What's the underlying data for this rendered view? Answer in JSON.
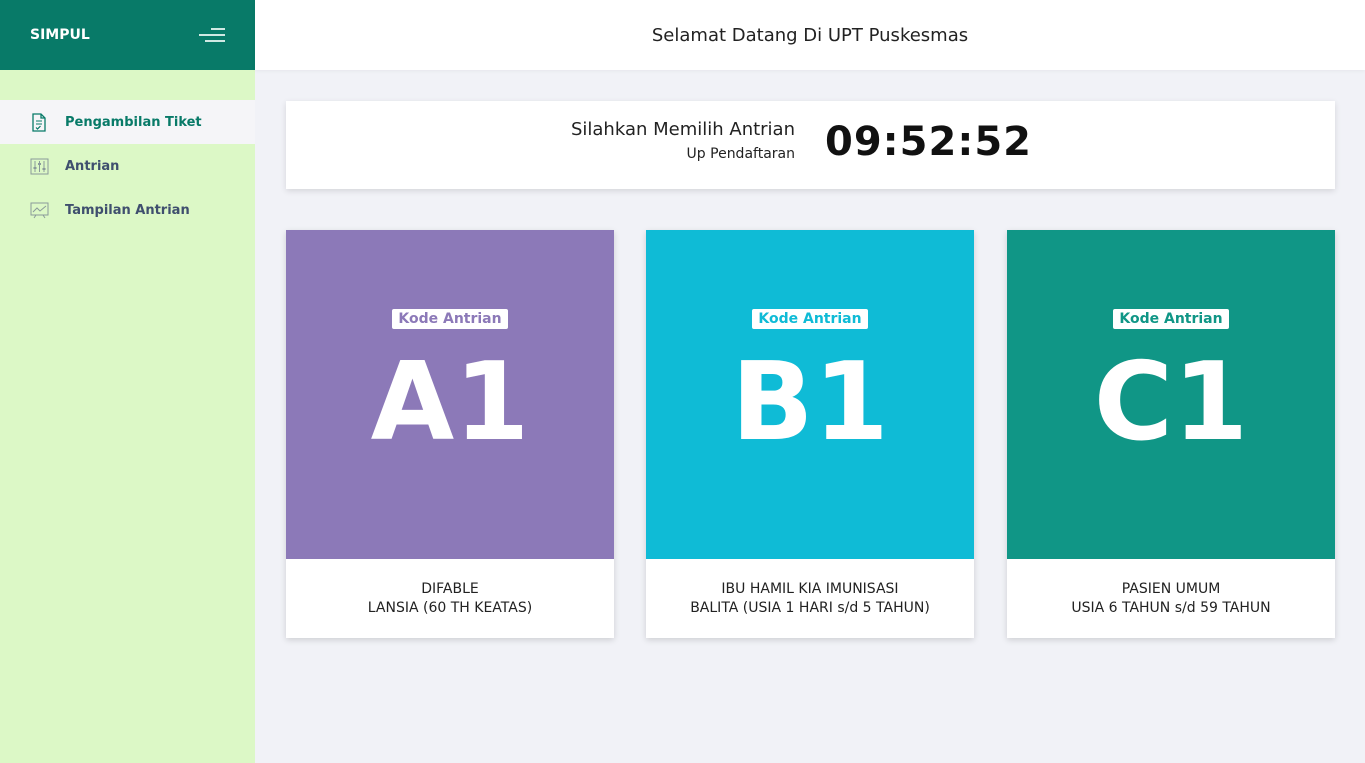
{
  "sidebar": {
    "brand": "SIMPUL",
    "items": [
      {
        "label": "Pengambilan Tiket",
        "icon": "document-check-icon",
        "active": true
      },
      {
        "label": "Antrian",
        "icon": "sliders-icon",
        "active": false
      },
      {
        "label": "Tampilan Antrian",
        "icon": "chart-line-icon",
        "active": false
      }
    ]
  },
  "header": {
    "title": "Selamat Datang Di UPT Puskesmas"
  },
  "info": {
    "heading": "Silahkan Memilih Antrian",
    "subheading": "Up Pendaftaran",
    "clock": "09:52:52"
  },
  "queues": [
    {
      "badge": "Kode Antrian",
      "code": "A1",
      "line1": "DIFABLE",
      "line2": "LANSIA (60 TH KEATAS)",
      "color": "#8c79b8"
    },
    {
      "badge": "Kode Antrian",
      "code": "B1",
      "line1": "IBU HAMIL KIA IMUNISASI",
      "line2": "BALITA (USIA 1 HARI s/d 5 TAHUN)",
      "color": "#0fbbd6"
    },
    {
      "badge": "Kode Antrian",
      "code": "C1",
      "line1": "PASIEN UMUM",
      "line2": "USIA 6 TAHUN s/d 59 TAHUN",
      "color": "#109686"
    }
  ]
}
